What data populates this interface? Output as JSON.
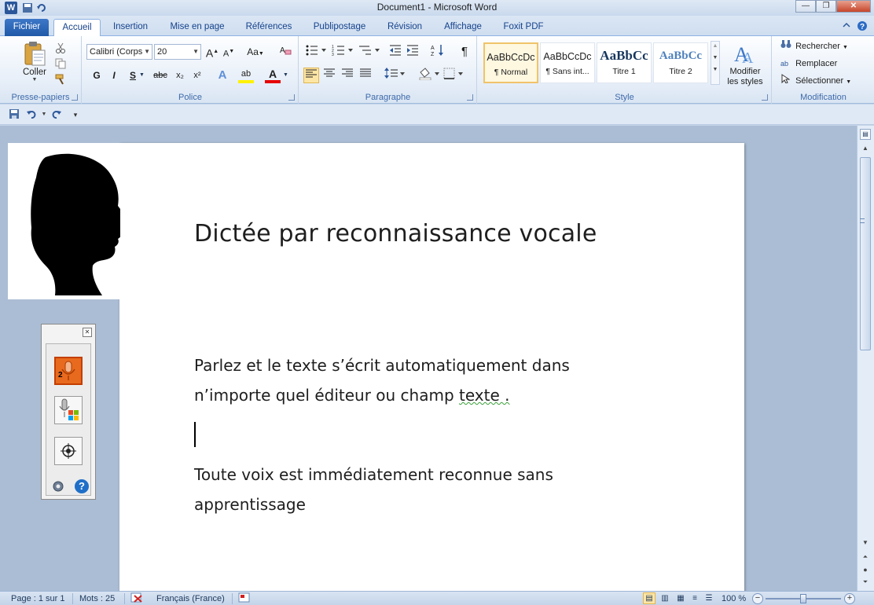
{
  "window": {
    "app_icon_letter": "W",
    "title": "Document1 - Microsoft Word",
    "minimize_label": "—",
    "maximize_label": "❐",
    "close_label": "✕"
  },
  "tabs": [
    {
      "label": "Fichier"
    },
    {
      "label": "Accueil"
    },
    {
      "label": "Insertion"
    },
    {
      "label": "Mise en page"
    },
    {
      "label": "Références"
    },
    {
      "label": "Publipostage"
    },
    {
      "label": "Révision"
    },
    {
      "label": "Affichage"
    },
    {
      "label": "Foxit PDF"
    }
  ],
  "ribbon": {
    "clipboard": {
      "label": "Presse-papiers",
      "paste_label": "Coller"
    },
    "police": {
      "label": "Police",
      "font_name": "Calibri (Corps",
      "font_size": "20",
      "grow_label": "A",
      "shrink_label": "A",
      "case_label": "Aa",
      "bold": "G",
      "italic": "I",
      "underline": "S",
      "strike": "abc",
      "subscript": "x₂",
      "superscript": "x²",
      "effects": "A",
      "highlight": "ab",
      "font_color": "A"
    },
    "paragraphe": {
      "label": "Paragraphe",
      "pilcrow": "¶"
    },
    "style": {
      "label": "Style",
      "styles": [
        {
          "sample": "AaBbCcDc",
          "name": "¶ Normal"
        },
        {
          "sample": "AaBbCcDc",
          "name": "¶ Sans int..."
        },
        {
          "sample": "AaBbCc",
          "name": "Titre 1"
        },
        {
          "sample": "AaBbCc",
          "name": "Titre 2"
        }
      ],
      "modify_line1": "Modifier",
      "modify_line2": "les styles"
    },
    "modification": {
      "label": "Modification",
      "find": "Rechercher",
      "replace": "Remplacer",
      "select": "Sélectionner"
    }
  },
  "document": {
    "title": "Dictée par reconnaissance  vocale",
    "para1_text": "Parlez et le texte s’écrit automatiquement dans n’importe quel  éditeur ou champ",
    "para1_tail": "texte .",
    "para2": "Toute voix est immédiatement reconnue sans apprentissage"
  },
  "speech_widget": {
    "close_label": "✕",
    "mic_number": "2",
    "help_label": "?"
  },
  "status": {
    "page": "Page : 1 sur 1",
    "words": "Mots : 25",
    "language": "Français (France)",
    "zoom": "100 %",
    "zoom_minus": "−",
    "zoom_plus": "+"
  },
  "colors": {
    "accent": "#2b579a",
    "ribbon_bg": "#e6eef8",
    "doc_bg": "#abbdd4",
    "active_style_border": "#f0c36a",
    "mic_active": "#e86a1e"
  }
}
